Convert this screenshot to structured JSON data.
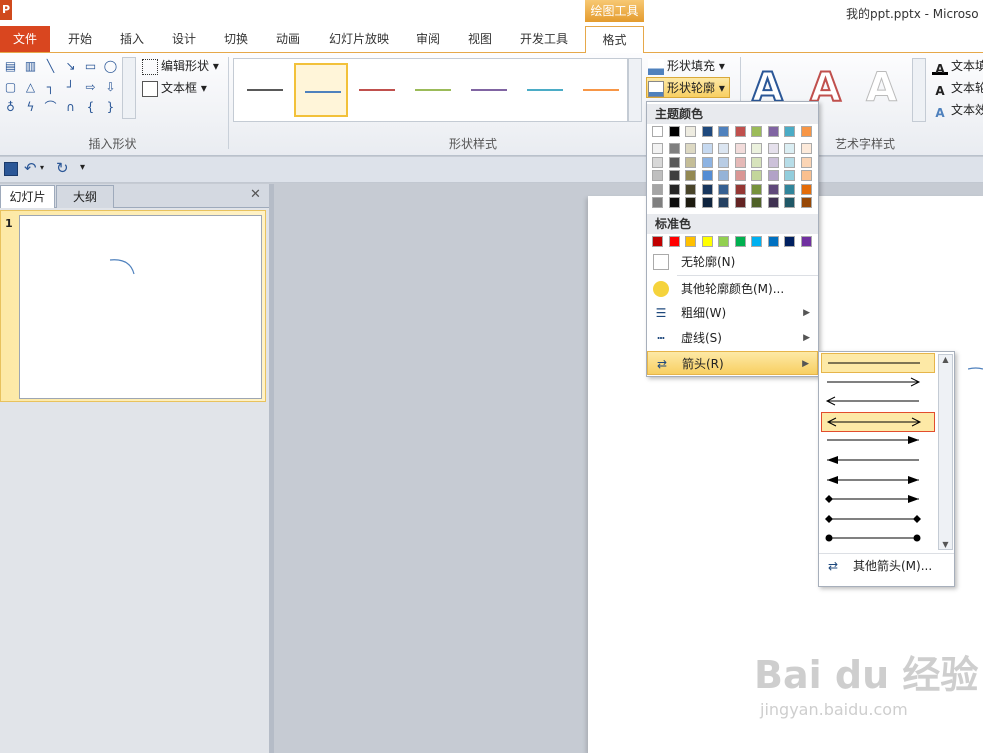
{
  "app": {
    "icon": "P",
    "document_title": "我的ppt.pptx - Microso",
    "context_tab_group": "绘图工具"
  },
  "tabs": [
    {
      "label": "文件"
    },
    {
      "label": "开始"
    },
    {
      "label": "插入"
    },
    {
      "label": "设计"
    },
    {
      "label": "切换"
    },
    {
      "label": "动画"
    },
    {
      "label": "幻灯片放映"
    },
    {
      "label": "审阅"
    },
    {
      "label": "视图"
    },
    {
      "label": "开发工具"
    },
    {
      "label": "格式"
    }
  ],
  "ribbon": {
    "insert_shapes": {
      "edit_shape": "编辑形状",
      "text_box": "文本框",
      "group_label": "插入形状"
    },
    "shape_styles": {
      "group_label": "形状样式",
      "fill": "形状填充",
      "outline": "形状轮廓",
      "swatches": [
        "#595959",
        "#4f81bd",
        "#c0504d",
        "#9bbb59",
        "#8064a2",
        "#4bacc6",
        "#f79646"
      ]
    },
    "wordart": {
      "group_label": "艺术字样式",
      "text_fill": "文本填",
      "text_outline": "文本轮",
      "text_effects": "文本效"
    }
  },
  "panel": {
    "tab_slides": "幻灯片",
    "tab_outline": "大纲",
    "close": "✕",
    "slide_number": "1"
  },
  "outline_menu": {
    "theme_colors_heading": "主题颜色",
    "theme_top_row": [
      "#ffffff",
      "#000000",
      "#eeece1",
      "#1f497d",
      "#4f81bd",
      "#c0504d",
      "#9bbb59",
      "#8064a2",
      "#4bacc6",
      "#f79646"
    ],
    "theme_shades": [
      [
        "#f2f2f2",
        "#7f7f7f",
        "#ddd9c3",
        "#c6d9f0",
        "#dbe5f1",
        "#f2dcdb",
        "#ebf1dd",
        "#e5e0ec",
        "#dbeef3",
        "#fdeada"
      ],
      [
        "#d8d8d8",
        "#595959",
        "#c4bd97",
        "#8db3e2",
        "#b8cce4",
        "#e5b9b7",
        "#d7e3bc",
        "#ccc1d9",
        "#b7dde8",
        "#fbd5b5"
      ],
      [
        "#bfbfbf",
        "#3f3f3f",
        "#938953",
        "#548dd4",
        "#95b3d7",
        "#d99694",
        "#c3d69b",
        "#b2a2c7",
        "#92cddc",
        "#fac08f"
      ],
      [
        "#a5a5a5",
        "#262626",
        "#494429",
        "#17365d",
        "#366092",
        "#953734",
        "#76923c",
        "#5f497a",
        "#31859b",
        "#e36c09"
      ],
      [
        "#7f7f7f",
        "#0c0c0c",
        "#1d1b10",
        "#0f243e",
        "#244061",
        "#632423",
        "#4f6128",
        "#3f3151",
        "#205867",
        "#974806"
      ]
    ],
    "standard_colors_heading": "标准色",
    "standard_colors": [
      "#c00000",
      "#ff0000",
      "#ffc000",
      "#ffff00",
      "#92d050",
      "#00b050",
      "#00b0f0",
      "#0070c0",
      "#002060",
      "#7030a0"
    ],
    "no_outline": "无轮廓(N)",
    "more_colors": "其他轮廓颜色(M)...",
    "weight": "粗细(W)",
    "dashes": "虚线(S)",
    "arrows": "箭头(R)"
  },
  "arrows_submenu": {
    "options": [
      {
        "style": "none"
      },
      {
        "style": "end-open"
      },
      {
        "style": "start-open"
      },
      {
        "style": "both-open"
      },
      {
        "style": "end-triangle"
      },
      {
        "style": "start-triangle"
      },
      {
        "style": "both-triangle"
      },
      {
        "style": "start-diamond-end-triangle"
      },
      {
        "style": "both-diamond"
      },
      {
        "style": "both-oval"
      }
    ],
    "more_arrows": "其他箭头(M)..."
  },
  "watermark": {
    "brand": "Bai du 经验",
    "url": "jingyan.baidu.com"
  }
}
